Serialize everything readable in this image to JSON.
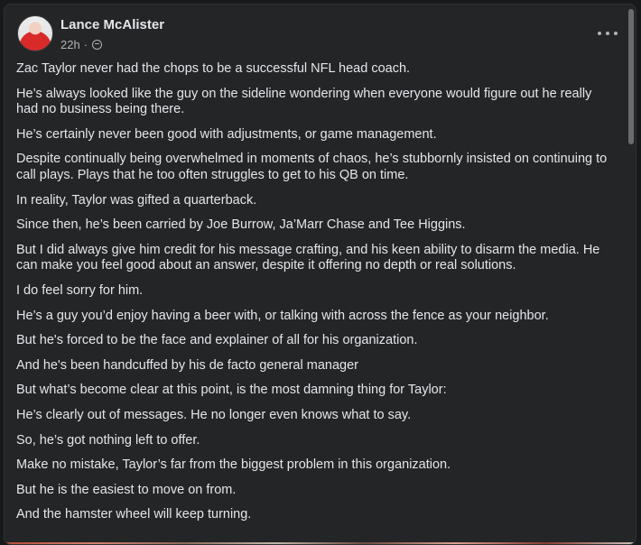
{
  "post": {
    "author": "Lance McAlister",
    "timestamp": "22h",
    "separator": "·",
    "avatar_icon": "user-avatar",
    "privacy_icon": "globe-icon",
    "more_icon": "more-options-icon",
    "paragraphs": [
      "Zac Taylor never had the chops to be a successful NFL head coach.",
      "He’s always looked like the guy on the sideline wondering when everyone would figure out he really had no business being there.",
      "He’s certainly never been good with adjustments, or game management.",
      "Despite continually being overwhelmed in moments of chaos, he’s stubbornly insisted on continuing to call plays. Plays that he too often struggles to get to his QB on time.",
      "In reality, Taylor was gifted a quarterback.",
      "Since then, he’s been carried by Joe Burrow, Ja’Marr Chase and Tee Higgins.",
      "But I did always give him credit for his message crafting, and his keen ability to disarm the media. He can make you feel good about an answer, despite it offering no depth or real solutions.",
      "I do feel sorry for him.",
      "He’s a guy you’d enjoy having a beer with, or talking with across the fence as your neighbor.",
      "But he's forced to be the face and explainer of all for his organization.",
      "And he's been handcuffed by his de facto general manager",
      "But what’s become clear at this point, is the most damning thing for Taylor:",
      "He’s clearly out of messages. He no longer even knows what to say.",
      "So, he’s got nothing left to offer.",
      "Make no mistake, Taylor’s far from the biggest problem in this organization.",
      "But he is the easiest to move on from.",
      "And the hamster wheel will keep turning."
    ]
  },
  "colors": {
    "background": "#18191a",
    "card": "#242526",
    "primary_text": "#e4e6eb",
    "secondary_text": "#b0b3b8"
  }
}
